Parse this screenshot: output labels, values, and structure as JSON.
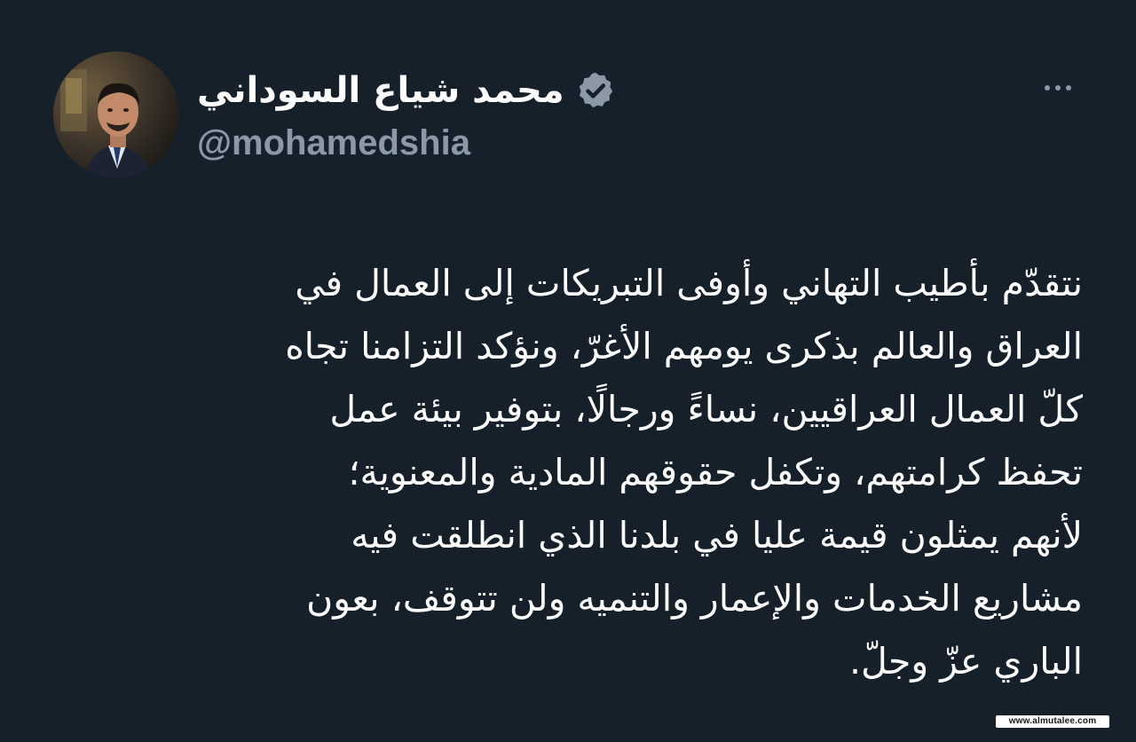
{
  "tweet": {
    "author": {
      "display_name": "محمد شياع السوداني",
      "handle": "@mohamedshia",
      "verified_icon": "verified-badge-icon",
      "avatar_icon": "profile-photo"
    },
    "more_icon": "more-options-icon",
    "text_lines": [
      "نتقدّم بأطيب التهاني وأوفى التبريكات إلى العمال في",
      "العراق والعالم بذكرى يومهم الأغرّ، ونؤكد التزامنا تجاه",
      "كلّ العمال العراقيين، نساءً ورجالًا، بتوفير بيئة عمل",
      "تحفظ كرامتهم، وتكفل حقوقهم المادية والمعنوية؛",
      "لأنهم يمثلون قيمة عليا في بلدنا الذي انطلقت فيه",
      "مشاريع الخدمات والإعمار والتنميه ولن تتوقف، بعون",
      "الباري عزّ وجلّ."
    ]
  },
  "watermark": {
    "text": "www.almutalee.com"
  },
  "colors": {
    "background": "#15202b",
    "text_primary": "#ffffff",
    "text_secondary": "#8b98a5",
    "verified_badge": "#8b98a5"
  }
}
